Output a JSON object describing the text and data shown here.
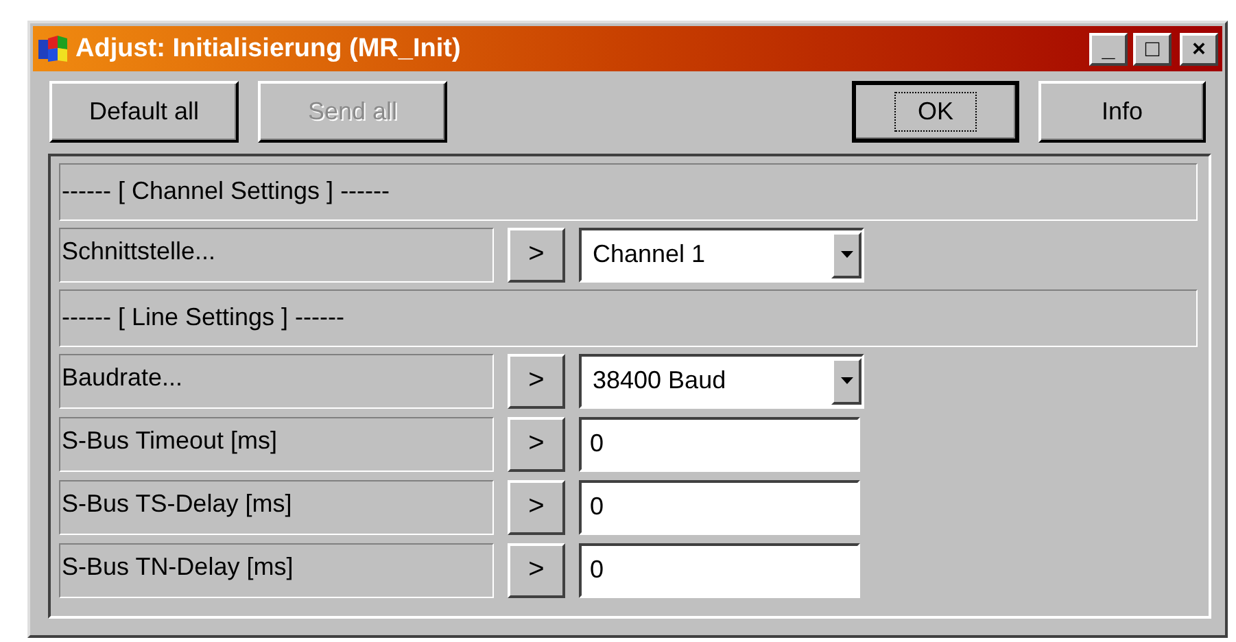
{
  "window": {
    "title": "Adjust: Initialisierung (MR_Init)",
    "controls": [
      "_",
      "□",
      "×"
    ]
  },
  "left_buttons": [
    {
      "label": "Default all",
      "disabled": false,
      "focused": false
    },
    {
      "label": "Send all",
      "disabled": true,
      "focused": false
    }
  ],
  "right_buttons": [
    {
      "label": "OK",
      "disabled": false,
      "focused": true
    },
    {
      "label": "Info",
      "disabled": false,
      "focused": false
    }
  ],
  "rows": [
    {
      "kind": "header",
      "label": "------ [ Channel Settings ] ------"
    },
    {
      "kind": "dropdown",
      "label": "Schnittstelle...",
      "button": ">",
      "value": "Channel 1"
    },
    {
      "kind": "header",
      "label": "------ [ Line Settings ] ------"
    },
    {
      "kind": "dropdown",
      "label": "Baudrate...",
      "button": ">",
      "value": "38400 Baud"
    },
    {
      "kind": "field",
      "label": "S-Bus Timeout [ms]",
      "button": ">",
      "value": "0"
    },
    {
      "kind": "field",
      "label": "S-Bus TS-Delay [ms]",
      "button": ">",
      "value": "0"
    },
    {
      "kind": "field",
      "label": "S-Bus TN-Delay [ms]",
      "button": ">",
      "value": "0"
    }
  ]
}
